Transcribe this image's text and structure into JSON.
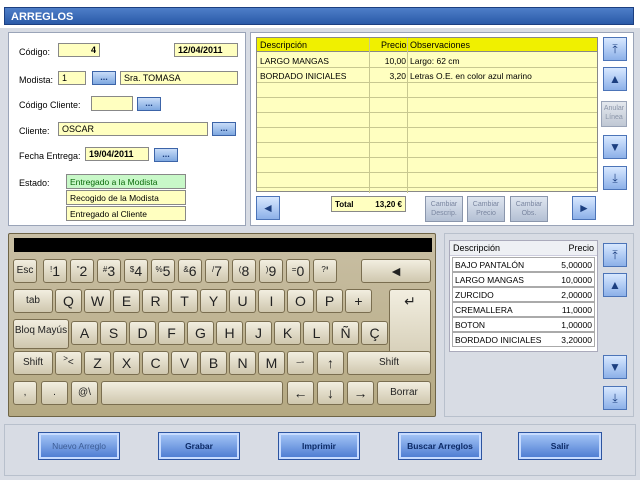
{
  "window": {
    "title": "ARREGLOS"
  },
  "form": {
    "codigo_label": "Código:",
    "codigo": "4",
    "fecha": "12/04/2011",
    "modista_label": "Modista:",
    "modista_id": "1",
    "modista_name": "Sra. TOMASA",
    "cod_cliente_label": "Código Cliente:",
    "cod_cliente": "",
    "cliente_label": "Cliente:",
    "cliente": "OSCAR",
    "fecha_entrega_label": "Fecha Entrega:",
    "fecha_entrega": "19/04/2011",
    "estado_label": "Estado:",
    "estados": [
      "Entregado a la Modista",
      "Recogido de la Modista",
      "Entregado al Cliente"
    ],
    "dots": "..."
  },
  "obs_table": {
    "headers": [
      "Descripción",
      "Precio",
      "Observaciones"
    ],
    "rows": [
      [
        "LARGO MANGAS",
        "10,00",
        "Largo: 62 cm"
      ],
      [
        "BORDADO INICIALES",
        "3,20",
        "Letras O.E. en color azul marino"
      ]
    ],
    "total_label": "Total",
    "total": "13,20 €"
  },
  "actions": {
    "anular": "Anular Línea",
    "cambiar_descrip": "Cambiar Descrip.",
    "cambiar_precio": "Cambiar Precio",
    "cambiar_obs": "Cambiar Obs."
  },
  "keyboard": {
    "row1": [
      [
        "Esc",
        ""
      ],
      [
        "1",
        "!"
      ],
      [
        "2",
        "\""
      ],
      [
        "3",
        "#"
      ],
      [
        "4",
        "$"
      ],
      [
        "5",
        "%"
      ],
      [
        "6",
        "&"
      ],
      [
        "7",
        "/"
      ],
      [
        "8",
        "("
      ],
      [
        "9",
        ")"
      ],
      [
        "0",
        "="
      ],
      [
        "'",
        "?"
      ]
    ],
    "row2": [
      "tab",
      "Q",
      "W",
      "E",
      "R",
      "T",
      "Y",
      "U",
      "I",
      "O",
      "P",
      "+"
    ],
    "row3": [
      "Bloq Mayús",
      "A",
      "S",
      "D",
      "F",
      "G",
      "H",
      "J",
      "K",
      "L",
      "Ñ",
      "Ç"
    ],
    "row4": [
      "Shift",
      "<",
      ">",
      "Z",
      "X",
      "C",
      "V",
      "B",
      "N",
      "M",
      "_",
      "-"
    ],
    "row5": [
      ",",
      ".",
      "@\\"
    ],
    "shift_right": "Shift",
    "borrar": "Borrar",
    "backspace": "◄",
    "enter": "↵"
  },
  "price_list": {
    "headers": [
      "Descripción",
      "Precio"
    ],
    "items": [
      [
        "BAJO PANTALÓN",
        "5,00000"
      ],
      [
        "LARGO MANGAS",
        "10,0000"
      ],
      [
        "ZURCIDO",
        "2,00000"
      ],
      [
        "CREMALLERA",
        "11,0000"
      ],
      [
        "BOTON",
        "1,00000"
      ],
      [
        "BORDADO INICIALES",
        "3,20000"
      ]
    ]
  },
  "bottom": {
    "nuevo": "Nuevo Arreglo",
    "grabar": "Grabar",
    "imprimir": "Imprimir",
    "buscar": "Buscar Arreglos",
    "salir": "Salir"
  },
  "colors": {
    "title_bar": "#2a5aa8",
    "field_bg": "#ffffc0",
    "header_bg": "#f0f000",
    "selected_state": "#c8f8c8"
  }
}
